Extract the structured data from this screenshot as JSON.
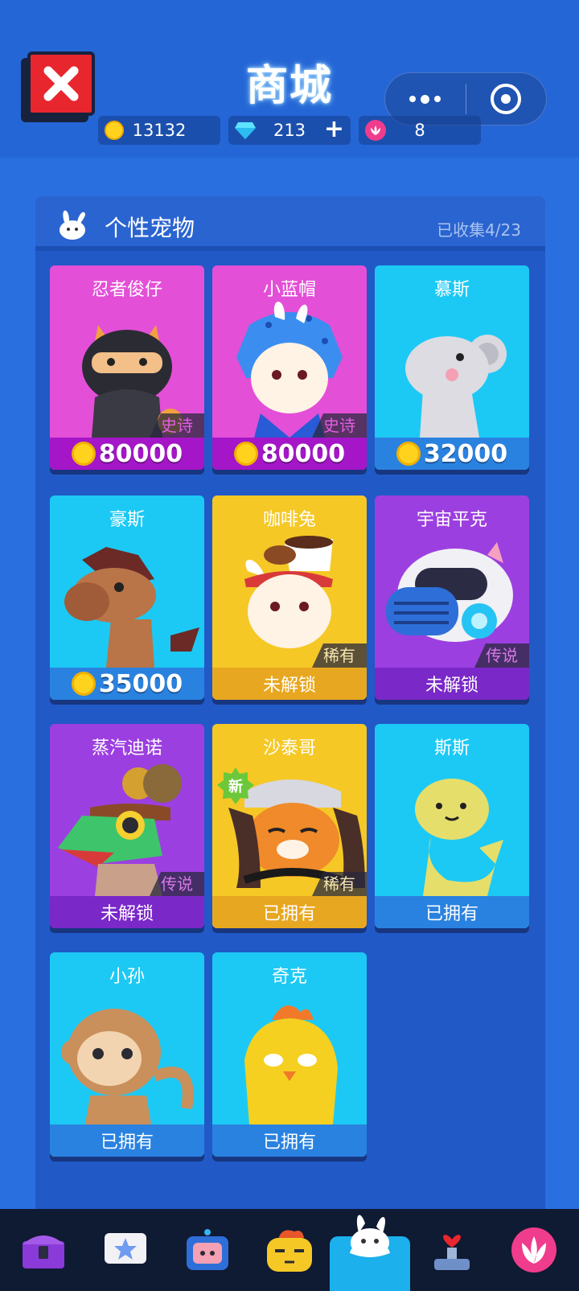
{
  "header": {
    "title": "商城",
    "currencies": {
      "gold": "13132",
      "gems": "213",
      "gems_add": "+",
      "lotus": "8"
    }
  },
  "panel": {
    "title": "个性宠物",
    "collected": "已收集4/23"
  },
  "pets": [
    {
      "name": "忍者俊仔",
      "footer": "80000",
      "rarity": "史诗",
      "theme": "pink",
      "price": true
    },
    {
      "name": "小蓝帽",
      "footer": "80000",
      "rarity": "史诗",
      "theme": "pink",
      "price": true
    },
    {
      "name": "慕斯",
      "footer": "32000",
      "rarity": "",
      "theme": "cyan",
      "price": true
    },
    {
      "name": "豪斯",
      "footer": "35000",
      "rarity": "",
      "theme": "cyan",
      "price": true
    },
    {
      "name": "咖啡兔",
      "footer": "未解锁",
      "rarity": "稀有",
      "theme": "yellow",
      "price": false
    },
    {
      "name": "宇宙平克",
      "footer": "未解锁",
      "rarity": "传说",
      "theme": "purple",
      "price": false
    },
    {
      "name": "蒸汽迪诺",
      "footer": "未解锁",
      "rarity": "传说",
      "theme": "purple",
      "price": false
    },
    {
      "name": "沙泰哥",
      "footer": "已拥有",
      "rarity": "稀有",
      "theme": "yellow",
      "price": false,
      "badge": "新"
    },
    {
      "name": "斯斯",
      "footer": "已拥有",
      "rarity": "",
      "theme": "cyan",
      "price": false
    },
    {
      "name": "小孙",
      "footer": "已拥有",
      "rarity": "",
      "theme": "cyan",
      "price": false
    },
    {
      "name": "奇克",
      "footer": "已拥有",
      "rarity": "",
      "theme": "cyan",
      "price": false
    }
  ],
  "nav": {
    "items": [
      "chest-icon",
      "star-card-icon",
      "tv-icon",
      "face-icon",
      "bunny-icon",
      "trophy-icon",
      "lotus-icon"
    ],
    "active": "bunny-icon"
  }
}
